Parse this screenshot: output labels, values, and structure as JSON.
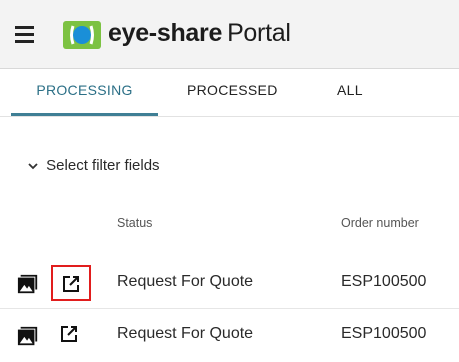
{
  "header": {
    "brand": "eye-share",
    "portal": "Portal",
    "logo_colors": {
      "green": "#7cc242",
      "blue": "#1a8fd8"
    }
  },
  "tabs": [
    {
      "label": "PROCESSING",
      "active": true
    },
    {
      "label": "PROCESSED",
      "active": false
    },
    {
      "label": "ALL",
      "active": false
    }
  ],
  "accent_color": "#2b6f86",
  "filter": {
    "label": "Select filter fields",
    "icon": "chevron-down-icon"
  },
  "table": {
    "headers": {
      "status": "Status",
      "order_number": "Order number"
    },
    "rows": [
      {
        "status": "Request For Quote",
        "order_number": "ESP100500",
        "highlighted": true
      },
      {
        "status": "Request For Quote",
        "order_number": "ESP100500",
        "highlighted": false
      }
    ],
    "row_icons": [
      "image-icon",
      "open-in-new-icon"
    ],
    "highlight_color": "#e11d1d"
  }
}
